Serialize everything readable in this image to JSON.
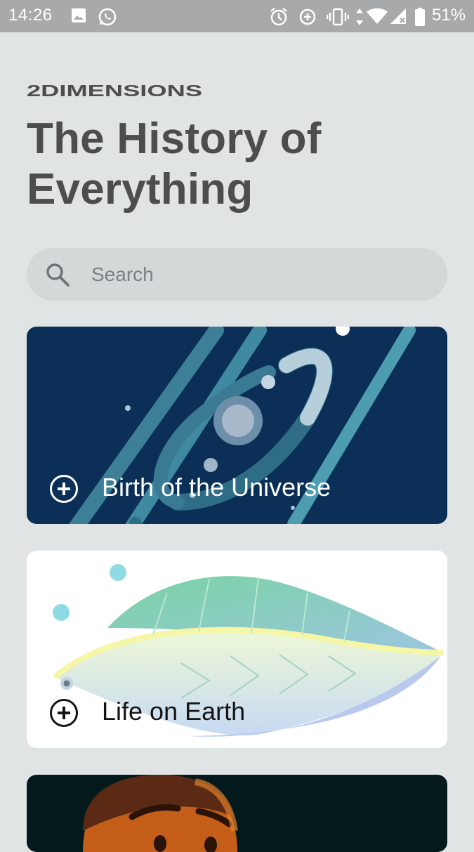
{
  "status_bar": {
    "time": "14:26",
    "battery_percent": "51%",
    "icons": [
      "image-icon",
      "whatsapp-icon",
      "alarm-icon",
      "data-saver-icon",
      "vibrate-icon",
      "data-arrows-icon",
      "wifi-icon",
      "signal-icon",
      "battery-icon"
    ]
  },
  "header": {
    "brand": "2DIMENSIONS",
    "title_line1": "The History of",
    "title_line2": "Everything"
  },
  "search": {
    "placeholder": "Search",
    "icon": "search-icon"
  },
  "cards": [
    {
      "label": "Birth of the Universe",
      "icon": "plus-circle-icon",
      "bg": "#0b2f57"
    },
    {
      "label": "Life on Earth",
      "icon": "plus-circle-icon",
      "bg": "#ffffff"
    },
    {
      "label": "",
      "icon": "",
      "bg": "#04191c"
    }
  ],
  "colors": {
    "background": "#e1e4e5",
    "status_bar": "#a7a9ab",
    "title": "#4b4d4f",
    "search_bg": "#d5d8d9"
  }
}
